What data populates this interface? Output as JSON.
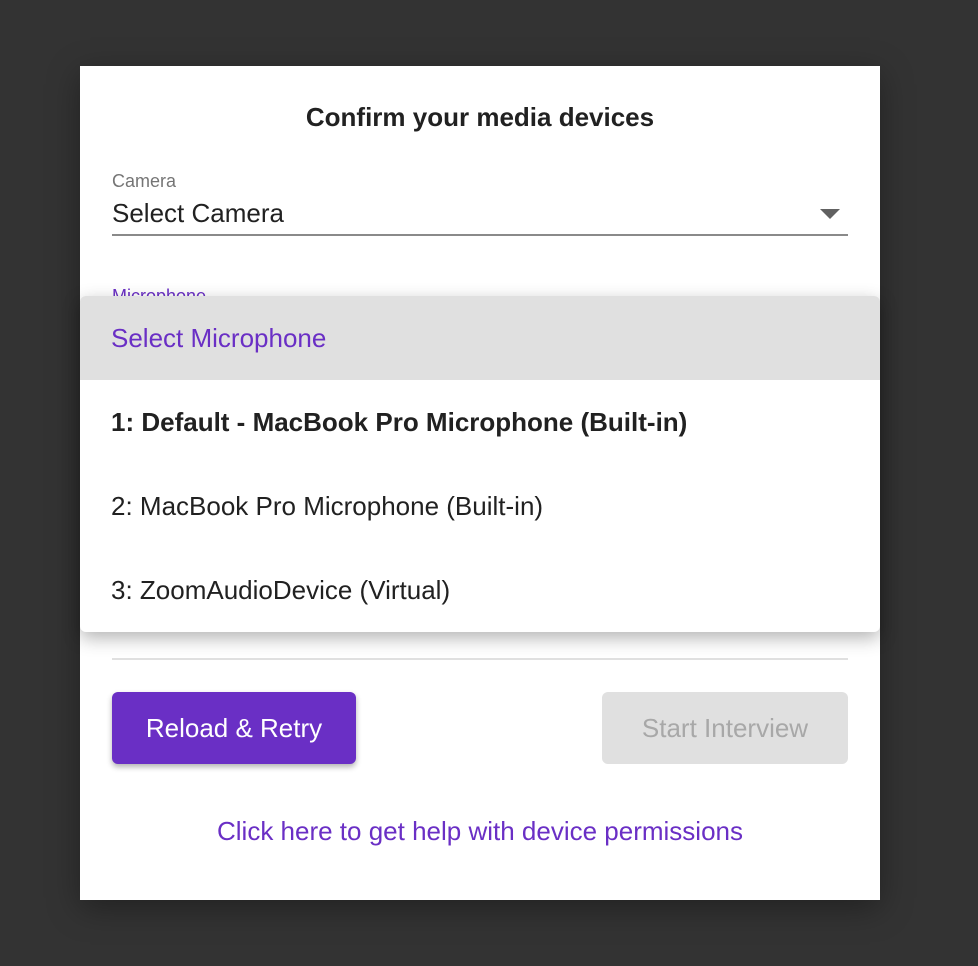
{
  "dialog": {
    "title": "Confirm your media devices"
  },
  "camera": {
    "label": "Camera",
    "value": "Select Camera"
  },
  "microphone": {
    "label": "Microphone"
  },
  "menu": {
    "items": [
      {
        "label": "Select Microphone"
      },
      {
        "label": "1: Default - MacBook Pro Microphone (Built-in)"
      },
      {
        "label": "2: MacBook Pro Microphone (Built-in)"
      },
      {
        "label": "3: ZoomAudioDevice (Virtual)"
      }
    ]
  },
  "buttons": {
    "reload": "Reload & Retry",
    "start": "Start Interview"
  },
  "help_link": "Click here to get help with device permissions",
  "colors": {
    "accent": "#6a2fc5",
    "backdrop": "#333333",
    "disabled": "#e0e0e0"
  }
}
